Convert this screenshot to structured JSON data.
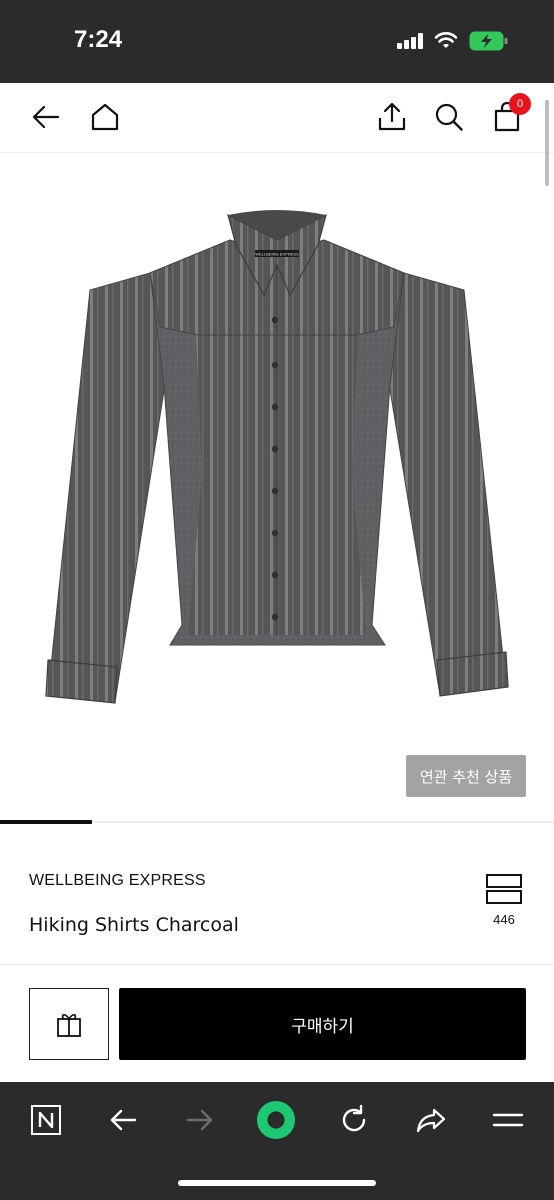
{
  "status_bar": {
    "time": "7:24",
    "battery_color": "#34c759"
  },
  "header": {
    "icons": [
      "back-arrow-icon",
      "home-icon",
      "share-icon",
      "search-icon",
      "shopping-bag-icon"
    ],
    "cart_count": "0",
    "badge_color": "#e8141c"
  },
  "product": {
    "image_alt": "striped charcoal hiking shirt",
    "label_text": "WELLBEING EXPRESS",
    "related_button": "연관 추천 상품",
    "brand": "WELLBEING EXPRESS",
    "name": "Hiking Shirts Charcoal",
    "like_count": "446"
  },
  "purchase": {
    "gift_icon": "gift-icon",
    "buy_label": "구매하기"
  },
  "browser_toolbar": {
    "icons": [
      "naver-logo-icon",
      "back-icon",
      "forward-icon",
      "green-dot-icon",
      "refresh-icon",
      "share-forward-icon",
      "menu-icon"
    ],
    "accent": "#1ec771"
  }
}
